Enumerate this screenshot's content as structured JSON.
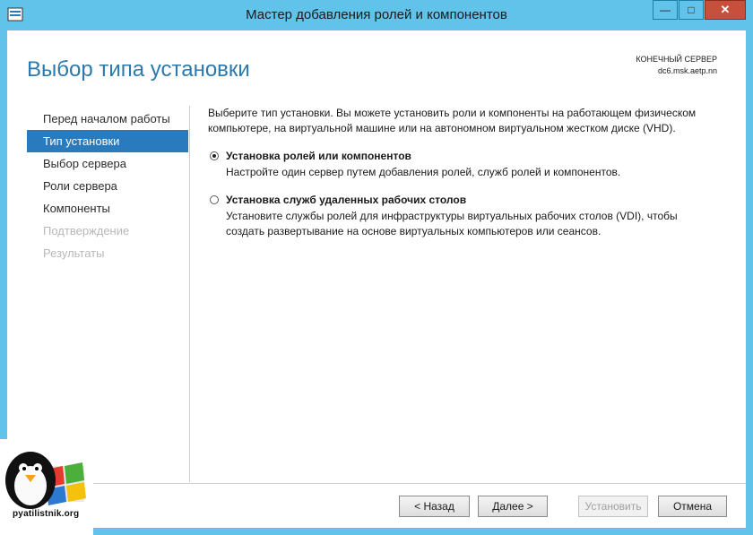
{
  "window": {
    "title": "Мастер добавления ролей и компонентов",
    "controls": {
      "minimize": "—",
      "maximize": "□",
      "close": "✕"
    }
  },
  "header": {
    "page_title": "Выбор типа установки",
    "server_caption_label": "КОНЕЧНЫЙ СЕРВЕР",
    "server_name": "dc6.msk.aetp.nn"
  },
  "nav": {
    "items": [
      {
        "label": "Перед началом работы",
        "state": "normal"
      },
      {
        "label": "Тип установки",
        "state": "active"
      },
      {
        "label": "Выбор сервера",
        "state": "normal"
      },
      {
        "label": "Роли сервера",
        "state": "normal"
      },
      {
        "label": "Компоненты",
        "state": "normal"
      },
      {
        "label": "Подтверждение",
        "state": "disabled"
      },
      {
        "label": "Результаты",
        "state": "disabled"
      }
    ]
  },
  "content": {
    "intro": "Выберите тип установки. Вы можете установить роли и компоненты на работающем физическом компьютере, на виртуальной машине или на автономном виртуальном жестком диске (VHD).",
    "options": [
      {
        "title": "Установка ролей или компонентов",
        "description": "Настройте один сервер путем добавления ролей, служб ролей и компонентов.",
        "selected": true
      },
      {
        "title": "Установка служб удаленных рабочих столов",
        "description": "Установите службы ролей для инфраструктуры виртуальных рабочих столов (VDI), чтобы создать развертывание на основе виртуальных компьютеров или сеансов.",
        "selected": false
      }
    ]
  },
  "buttons": {
    "back": "< Назад",
    "next": "Далее >",
    "install": "Установить",
    "cancel": "Отмена"
  },
  "watermark": {
    "text": "pyatilistnik.org"
  },
  "colors": {
    "titlebar": "#62c3ea",
    "accent": "#2a7bbd",
    "close": "#c7503d",
    "title_blue": "#2b79ad"
  }
}
